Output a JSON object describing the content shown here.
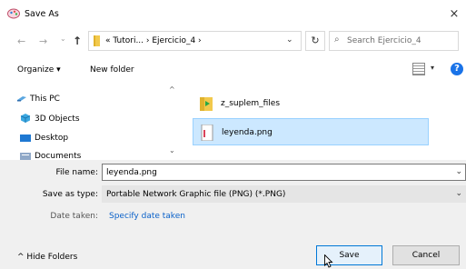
{
  "window": {
    "title": "Save As",
    "close_glyph": "×"
  },
  "nav": {
    "back_glyph": "←",
    "forward_glyph": "→",
    "recent_glyph": "⌄",
    "up_glyph": "↑",
    "breadcrumbs": "« Tutori...  ›  Ejercicio_4  ›",
    "address_dropdown_glyph": "⌄",
    "refresh_glyph": "↻",
    "search_glyph": "⌕",
    "search_placeholder": "Search Ejercicio_4"
  },
  "toolbar": {
    "organize_label": "Organize ▾",
    "new_folder_label": "New folder",
    "view_chevron": "▾",
    "help_glyph": "?"
  },
  "nav_pane": {
    "items": [
      {
        "label": "This PC",
        "icon": "computer-icon"
      },
      {
        "label": "3D Objects",
        "icon": "cube-icon"
      },
      {
        "label": "Desktop",
        "icon": "desktop-icon"
      },
      {
        "label": "Documents",
        "icon": "documents-icon"
      }
    ],
    "scroll_up_glyph": "^",
    "scroll_down_glyph": "⌄"
  },
  "files": [
    {
      "name": "z_suplem_files",
      "icon": "folder-icon",
      "selected": false
    },
    {
      "name": "leyenda.png",
      "icon": "image-file-icon",
      "selected": true
    }
  ],
  "form": {
    "file_name_label": "File name:",
    "file_name_value": "leyenda.png",
    "save_type_label": "Save as type:",
    "save_type_value": "Portable Network Graphic file (PNG) (*.PNG)",
    "date_taken_label": "Date taken:",
    "date_taken_link": "Specify date taken",
    "dropdown_glyph": "⌄"
  },
  "footer": {
    "hide_folders_label": "^  Hide Folders",
    "save_label": "Save",
    "cancel_label": "Cancel"
  },
  "colors": {
    "accent": "#0078d7",
    "selection": "#cce8ff",
    "link": "#0a61c9",
    "bottom_bg": "#f0f0f0"
  }
}
